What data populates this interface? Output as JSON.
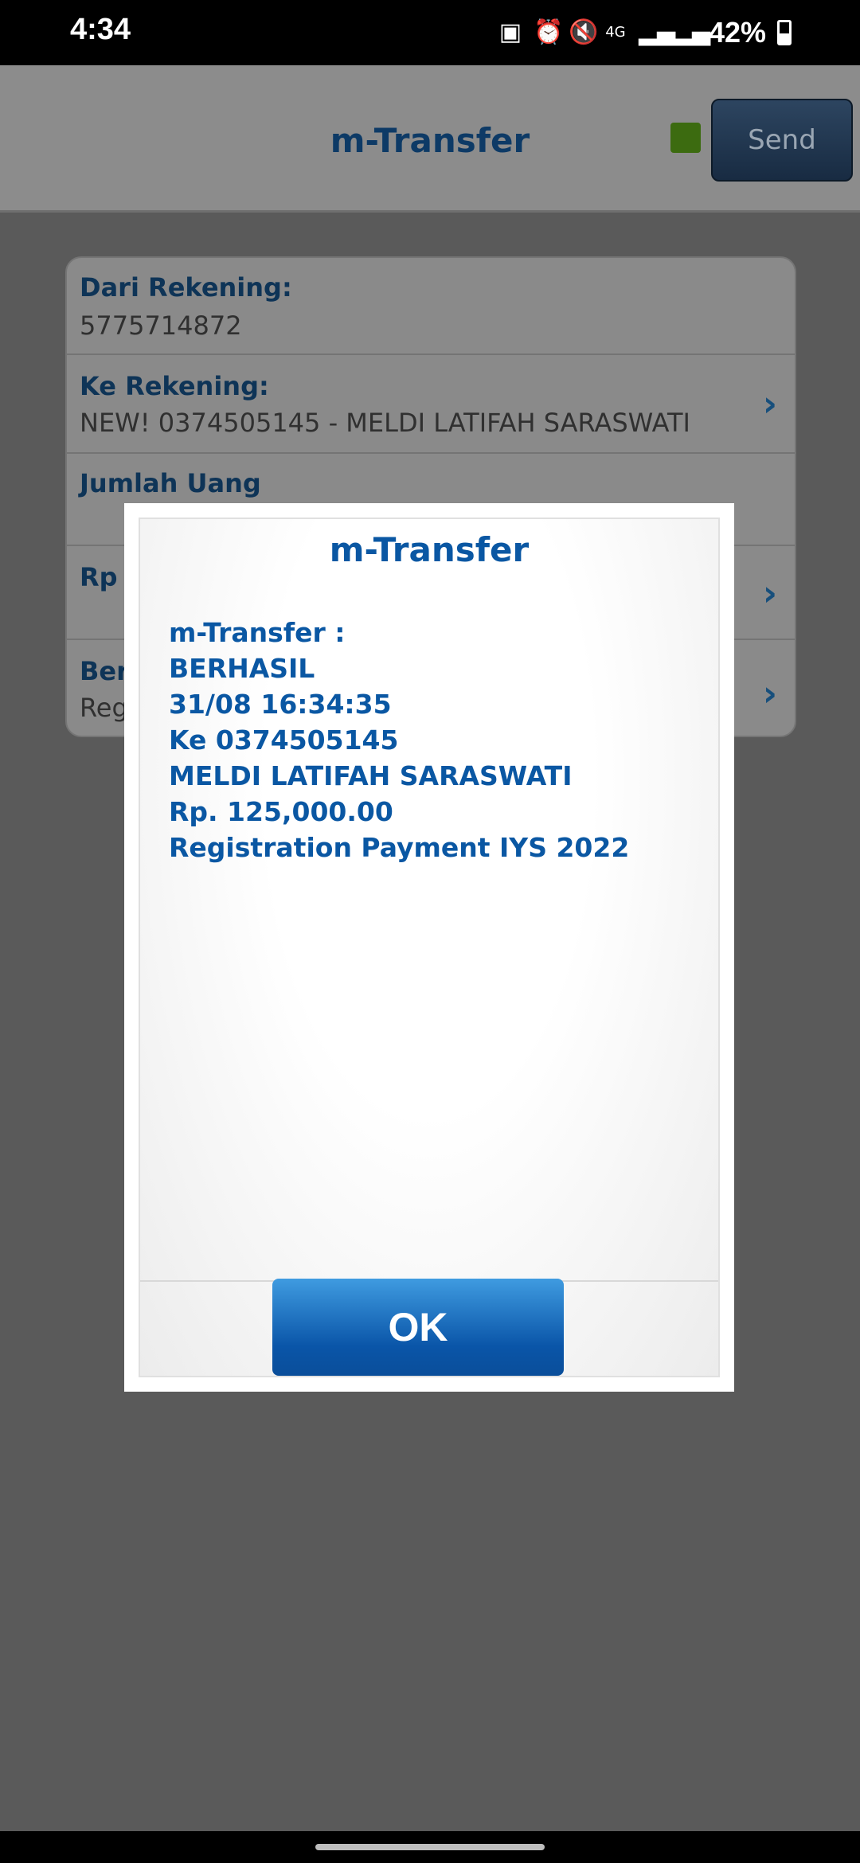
{
  "status_bar": {
    "time": "4:34",
    "network": "4G",
    "battery": "42%"
  },
  "header": {
    "title": "m-Transfer",
    "send_label": "Send",
    "indicator_color": "#6aa121"
  },
  "form": {
    "rows": [
      {
        "label": "Dari Rekening:",
        "value": "5775714872"
      },
      {
        "label": "Ke Rekening:",
        "value": "NEW! 0374505145 - MELDI LATIFAH SARASWATI"
      },
      {
        "label": "Jumlah Uang",
        "value": ""
      },
      {
        "label": "Rp",
        "value": ""
      },
      {
        "label": "Beri",
        "value": "Reg"
      }
    ]
  },
  "dialog": {
    "title": "m-Transfer",
    "lines": [
      "m-Transfer :",
      "BERHASIL",
      "31/08 16:34:35",
      "Ke 0374505145",
      "MELDI LATIFAH SARASWATI",
      "Rp. 125,000.00",
      "Registration Payment IYS 2022"
    ],
    "ok_label": "OK"
  }
}
